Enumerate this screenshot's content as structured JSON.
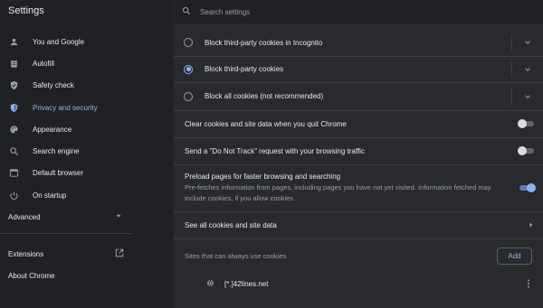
{
  "app": {
    "title": "Settings"
  },
  "search": {
    "placeholder": "Search settings"
  },
  "sidebar": {
    "items": [
      {
        "label": "You and Google",
        "icon": "person-icon"
      },
      {
        "label": "Autofill",
        "icon": "clipboard-icon"
      },
      {
        "label": "Safety check",
        "icon": "shield-check-icon"
      },
      {
        "label": "Privacy and security",
        "icon": "shield-icon"
      },
      {
        "label": "Appearance",
        "icon": "palette-icon"
      },
      {
        "label": "Search engine",
        "icon": "search-icon"
      },
      {
        "label": "Default browser",
        "icon": "browser-icon"
      },
      {
        "label": "On startup",
        "icon": "power-icon"
      }
    ],
    "advanced": "Advanced",
    "extensions": "Extensions",
    "about": "About Chrome"
  },
  "cookies": {
    "options": [
      {
        "label": "Block third-party cookies in Incognito",
        "selected": false
      },
      {
        "label": "Block third-party cookies",
        "selected": true
      },
      {
        "label": "Block all cookies (not recommended)",
        "selected": false
      }
    ],
    "clear_on_quit": {
      "label": "Clear cookies and site data when you quit Chrome",
      "on": false
    },
    "do_not_track": {
      "label": "Send a \"Do Not Track\" request with your browsing traffic",
      "on": false
    },
    "preload": {
      "label": "Preload pages for faster browsing and searching",
      "desc": "Pre-fetches information from pages, including pages you have not yet visited. Information fetched may include cookies, if you allow cookies.",
      "on": true
    },
    "see_all": "See all cookies and site data",
    "allowed_sites": {
      "label": "Sites that can always use cookies",
      "add_label": "Add",
      "sites": [
        "[*.]42lines.net"
      ]
    }
  },
  "colors": {
    "accent": "#8ab4f8",
    "background": "#202124",
    "panel": "#292a2d"
  }
}
